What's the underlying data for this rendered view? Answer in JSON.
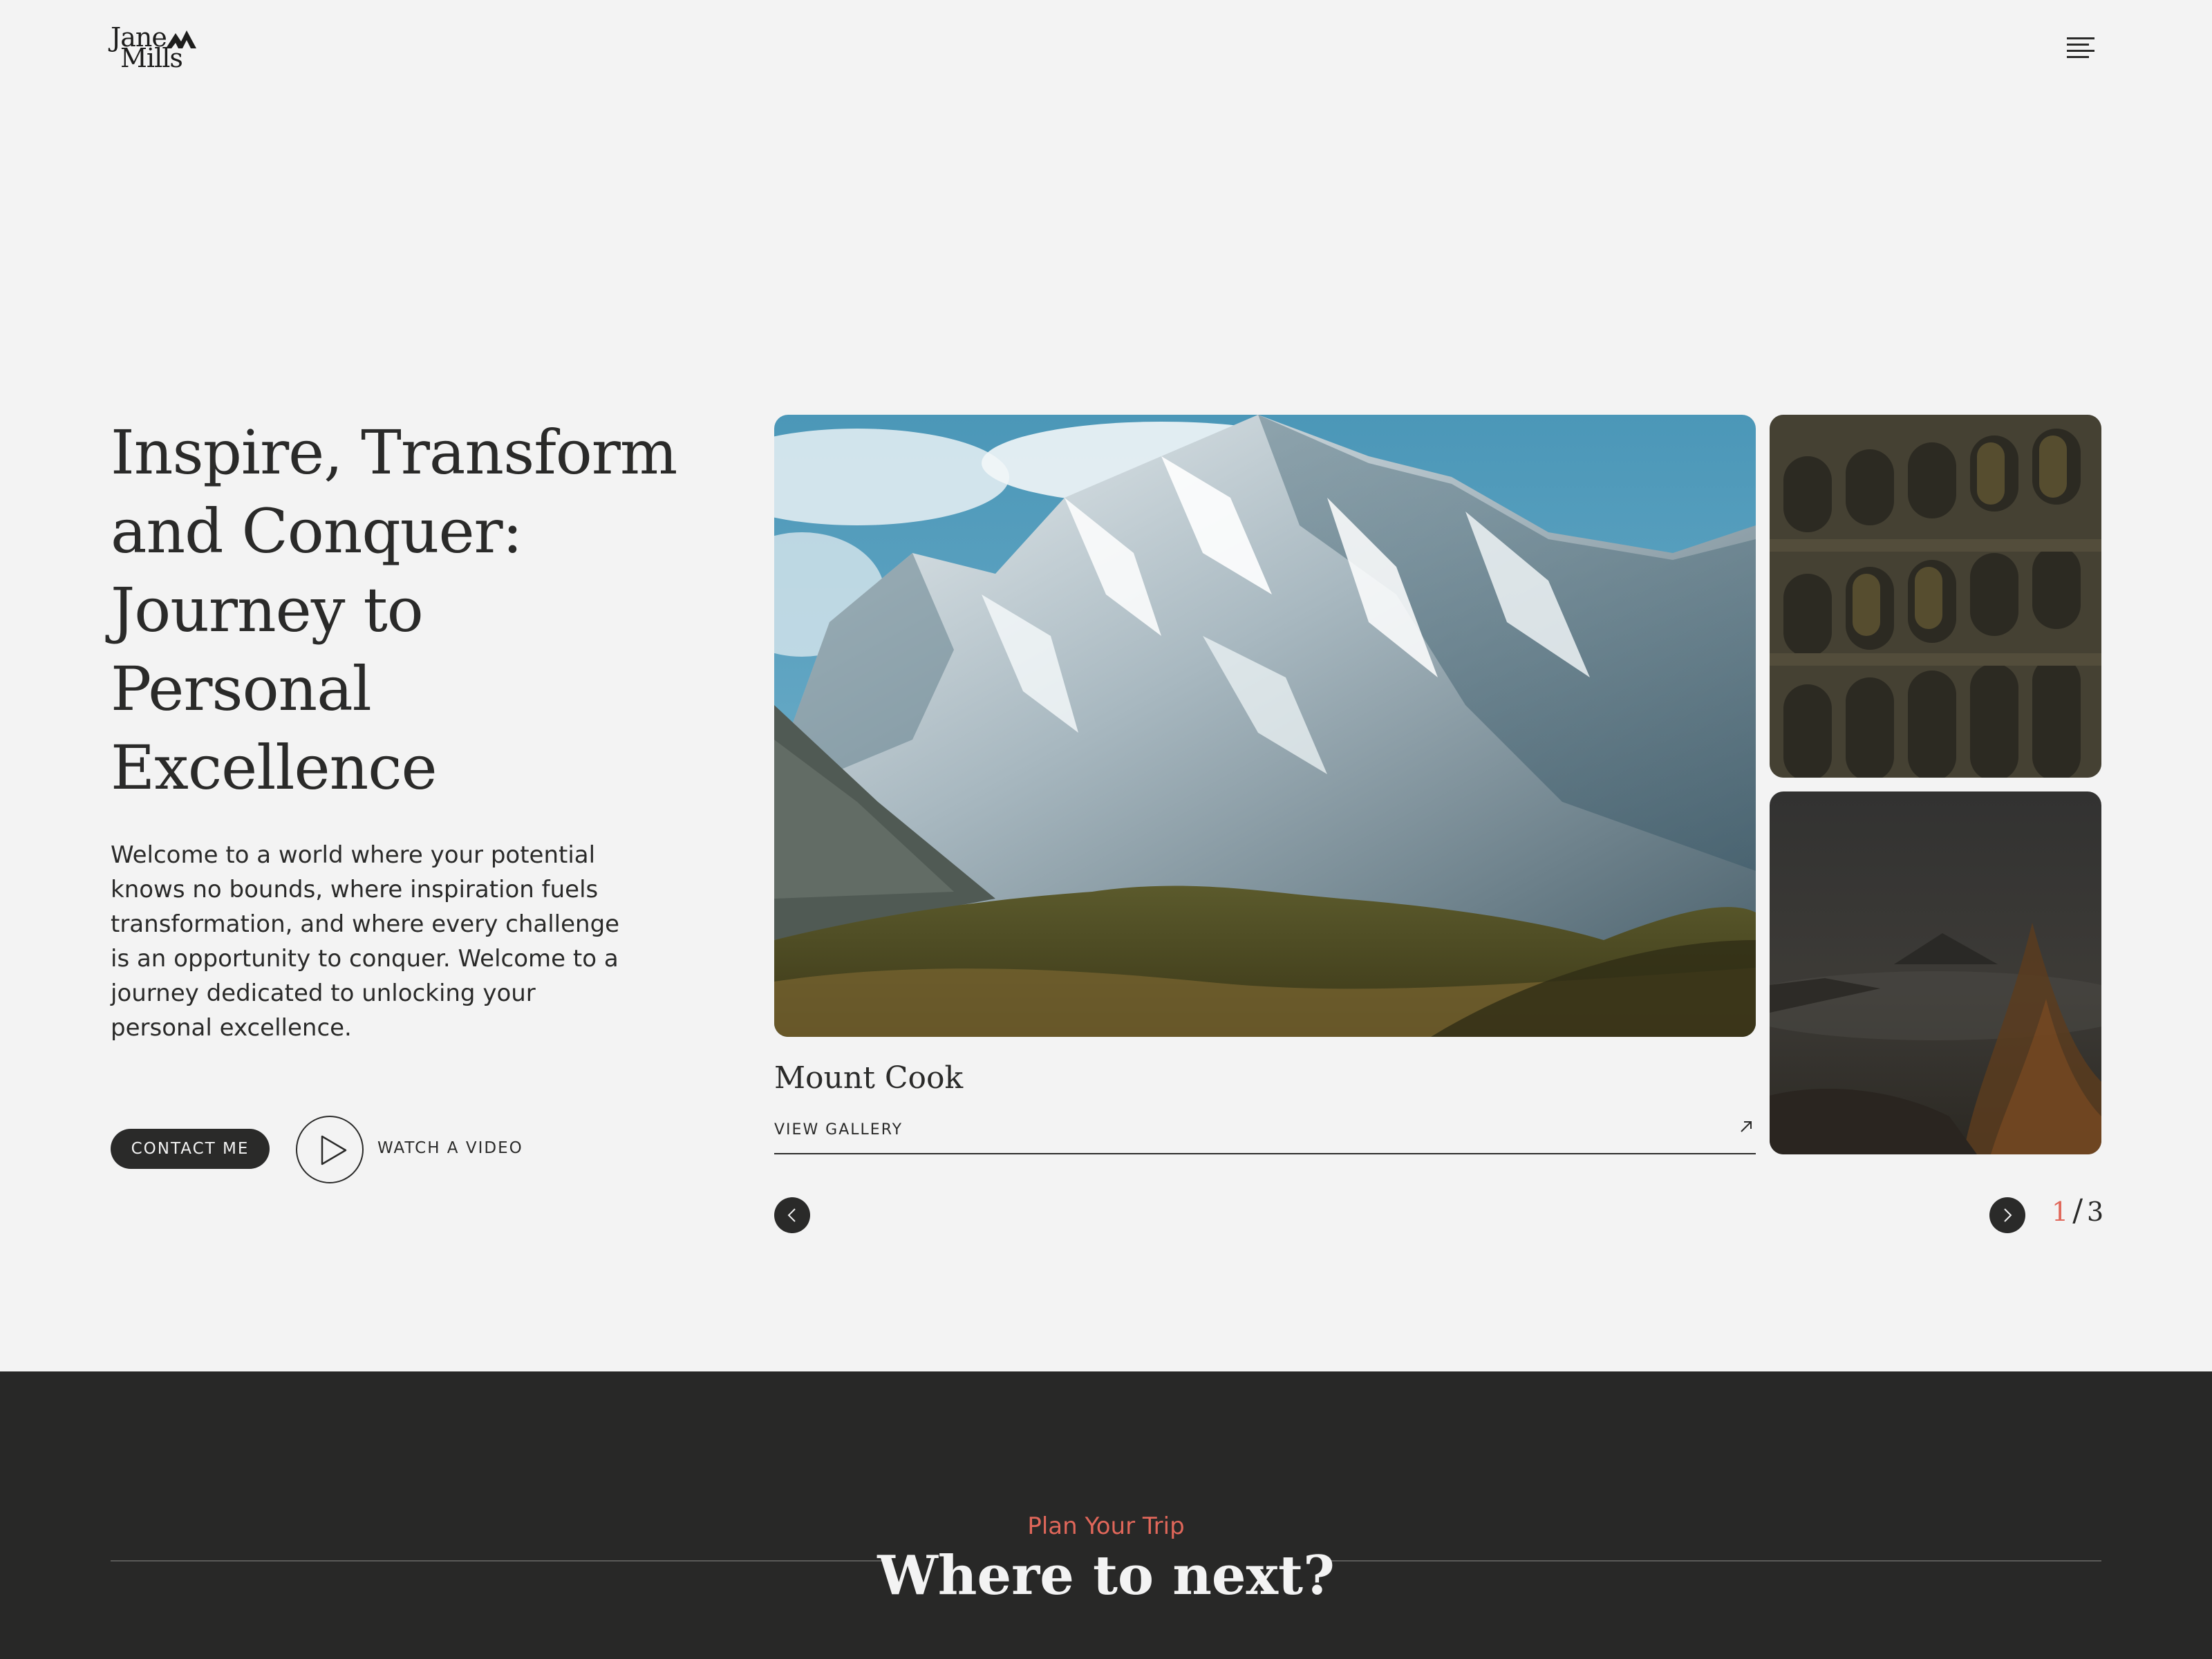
{
  "brand": {
    "line1": "Jane",
    "line2": "Mills"
  },
  "hero": {
    "title": "Inspire, Transform and Conquer: Journey to Personal Excellence",
    "text": "Welcome to a world where your potential knows no bounds, where inspiration fuels transformation, and where every challenge is an opportunity to conquer. Welcome to a journey dedicated to unlocking your personal excellence.",
    "contact_label": "CONTACT ME",
    "video_label": "WATCH A VIDEO"
  },
  "slider": {
    "title": "Mount Cook",
    "gallery_label": "VIEW GALLERY",
    "current": "1",
    "separator": "/",
    "total": "3"
  },
  "section": {
    "eyebrow": "Plan Your Trip",
    "title": "Where to next?"
  },
  "colors": {
    "background": "#f3f3f3",
    "text": "#2a2a29",
    "accent": "#e0675a",
    "dark": "#282827"
  },
  "icons": [
    "mountain-logo-icon",
    "menu-icon",
    "play-icon",
    "arrow-up-right-icon",
    "chevron-left-icon",
    "chevron-right-icon"
  ]
}
